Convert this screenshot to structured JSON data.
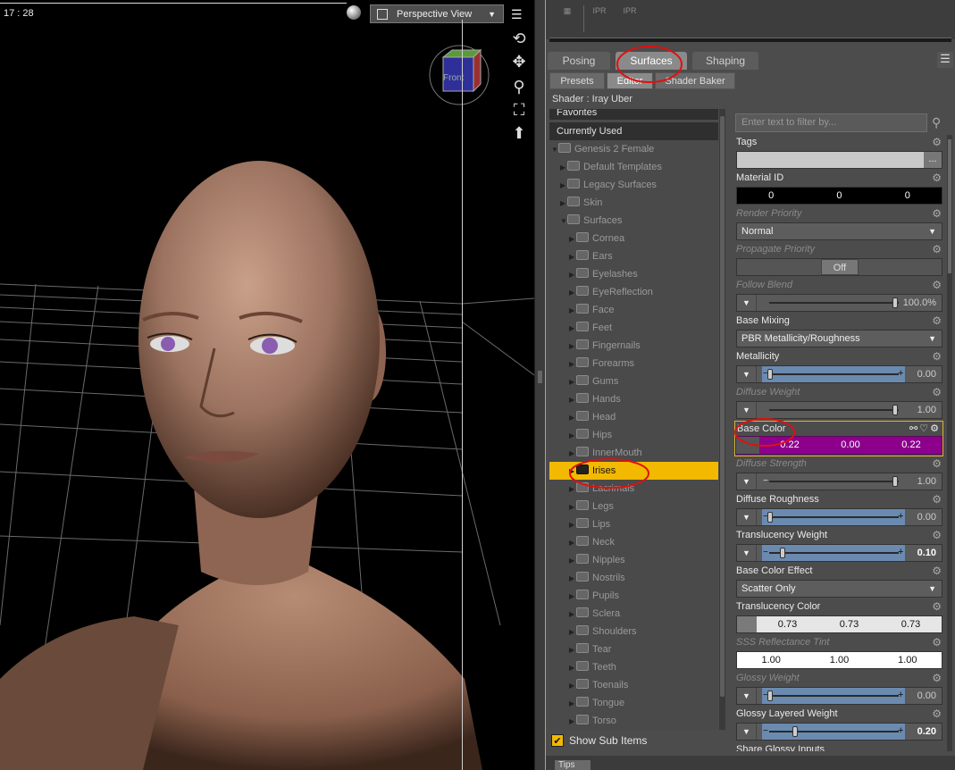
{
  "viewport": {
    "time": "17 : 28",
    "view_name": "Perspective View",
    "cube_label": "Front"
  },
  "toolbar": {
    "ipr1": "IPR",
    "ipr2": "IPR"
  },
  "tabs": {
    "main": [
      "Posing",
      "Surfaces",
      "Shaping"
    ],
    "active_main": "Surfaces",
    "sub": [
      "Presets",
      "Editor",
      "Shader Baker"
    ],
    "active_sub": "Editor"
  },
  "shader_label": "Shader : Iray Uber",
  "tree": {
    "favorites": "Favorites",
    "currently_used": "Currently Used",
    "figure": "Genesis 2 Female",
    "groups": [
      "Default Templates",
      "Legacy Surfaces",
      "Skin"
    ],
    "surfaces_label": "Surfaces",
    "surfaces": [
      "Cornea",
      "Ears",
      "Eyelashes",
      "EyeReflection",
      "Face",
      "Feet",
      "Fingernails",
      "Forearms",
      "Gums",
      "Hands",
      "Head",
      "Hips",
      "InnerMouth",
      "Irises",
      "Lacrimals",
      "Legs",
      "Lips",
      "Neck",
      "Nipples",
      "Nostrils",
      "Pupils",
      "Sclera",
      "Shoulders",
      "Tear",
      "Teeth",
      "Toenails",
      "Tongue",
      "Torso"
    ],
    "selected": "Irises",
    "show_sub_items": "Show Sub Items"
  },
  "filter_placeholder": "Enter text to filter by...",
  "props": {
    "tags": "Tags",
    "tags_more": "...",
    "material_id": {
      "label": "Material ID",
      "values": [
        "0",
        "0",
        "0"
      ]
    },
    "render_priority": {
      "label": "Render Priority",
      "value": "Normal"
    },
    "propagate_priority": {
      "label": "Propagate Priority",
      "value": "Off"
    },
    "follow_blend": {
      "label": "Follow Blend",
      "value": "100.0%",
      "level": 1.0
    },
    "base_mixing": {
      "label": "Base Mixing",
      "value": "PBR Metallicity/Roughness"
    },
    "metallicity": {
      "label": "Metallicity",
      "value": "0.00",
      "level": 0.0
    },
    "diffuse_weight": {
      "label": "Diffuse Weight",
      "value": "1.00",
      "level": 1.0
    },
    "base_color": {
      "label": "Base Color",
      "values": [
        "0.22",
        "0.00",
        "0.22"
      ],
      "color": "#8c008c"
    },
    "diffuse_strength": {
      "label": "Diffuse Strength",
      "value": "1.00",
      "level": 1.0
    },
    "diffuse_roughness": {
      "label": "Diffuse Roughness",
      "value": "0.00",
      "level": 0.0
    },
    "translucency_weight": {
      "label": "Translucency Weight",
      "value": "0.10",
      "level": 0.1
    },
    "base_color_effect": {
      "label": "Base Color Effect",
      "value": "Scatter Only"
    },
    "translucency_color": {
      "label": "Translucency Color",
      "values": [
        "0.73",
        "0.73",
        "0.73"
      ]
    },
    "sss_tint": {
      "label": "SSS Reflectance Tint",
      "values": [
        "1.00",
        "1.00",
        "1.00"
      ]
    },
    "glossy_weight": {
      "label": "Glossy Weight",
      "value": "0.00",
      "level": 0.0
    },
    "glossy_layered_weight": {
      "label": "Glossy Layered Weight",
      "value": "0.20",
      "level": 0.2
    },
    "share_glossy": {
      "label": "Share Glossy Inputs"
    }
  },
  "bottom_tab": "Tips",
  "colors": {
    "selection": "#f2b900",
    "annotation": "#e01010",
    "base_color": "#8c008c"
  }
}
